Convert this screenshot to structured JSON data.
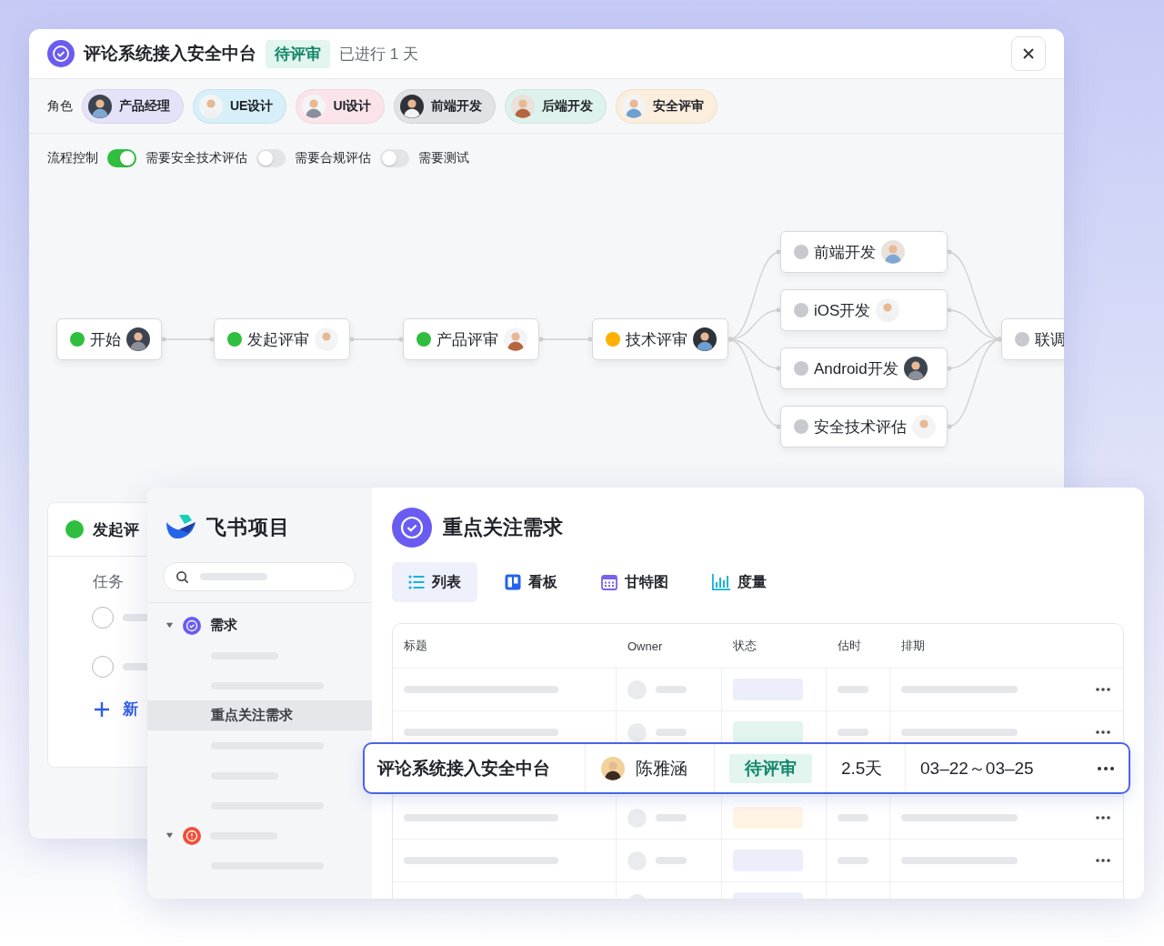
{
  "window": {
    "title": "评论系统接入安全中台",
    "status": "待评审",
    "elapsed": "已进行 1 天"
  },
  "roles": {
    "label": "角色",
    "items": [
      {
        "name": "产品经理",
        "color": "#e4e2f8"
      },
      {
        "name": "UE设计",
        "color": "#d6eff8"
      },
      {
        "name": "UI设计",
        "color": "#fae4ea"
      },
      {
        "name": "前端开发",
        "color": "#e1e2e6"
      },
      {
        "name": "后端开发",
        "color": "#ddf2ec"
      },
      {
        "name": "安全评审",
        "color": "#fbeedc"
      }
    ]
  },
  "flow_control": {
    "label": "流程控制",
    "options": [
      {
        "on": true,
        "label": "需要安全技术评估"
      },
      {
        "on": false,
        "label": "需要合规评估"
      },
      {
        "on": false,
        "label": "需要测试"
      }
    ]
  },
  "flow": {
    "stages": [
      [
        {
          "label": "开始",
          "color": "#2fbe3e",
          "avatar": true
        }
      ],
      [
        {
          "label": "发起评审",
          "color": "#2fbe3e",
          "avatar": true
        }
      ],
      [
        {
          "label": "产品评审",
          "color": "#2fbe3e",
          "avatar": true
        }
      ],
      [
        {
          "label": "技术评审",
          "color": "#ffb000",
          "avatar": true
        }
      ],
      [
        {
          "label": "前端开发",
          "color": "#c8c9cf",
          "avatar": true
        },
        {
          "label": "iOS开发",
          "color": "#c8c9cf",
          "avatar": true
        },
        {
          "label": "Android开发",
          "color": "#c8c9cf",
          "avatar": true
        },
        {
          "label": "安全技术评估",
          "color": "#c8c9cf",
          "avatar": true
        }
      ],
      [
        {
          "label": "联调",
          "color": "#c8c9cf",
          "avatar": false
        }
      ]
    ]
  },
  "stage_card": {
    "title": "发起评",
    "color": "#2fbe3e",
    "section": "任务",
    "tasks": [
      {
        "checked": false
      },
      {
        "checked": false
      }
    ],
    "add": "新"
  },
  "app": {
    "logo": "飞书项目",
    "sidebar": {
      "groups": [
        {
          "kind": "requirement",
          "label": "需求",
          "expanded": true,
          "children": [
            {
              "kind": "short",
              "selected": false
            },
            {
              "kind": "long",
              "selected": false
            },
            {
              "kind": "item",
              "label": "重点关注需求",
              "selected": true
            },
            {
              "kind": "long",
              "selected": false
            },
            {
              "kind": "short",
              "selected": false
            },
            {
              "kind": "long",
              "selected": false
            }
          ]
        },
        {
          "kind": "issue",
          "expanded": true,
          "children": [
            {
              "kind": "long",
              "selected": false
            }
          ]
        }
      ]
    },
    "page": {
      "title": "重点关注需求",
      "tabs": [
        {
          "label": "列表",
          "kind": "list",
          "selected": true
        },
        {
          "label": "看板",
          "kind": "board",
          "selected": false
        },
        {
          "label": "甘特图",
          "kind": "gantt",
          "selected": false
        },
        {
          "label": "度量",
          "kind": "metrics",
          "selected": false
        }
      ],
      "table": {
        "columns": [
          "标题",
          "Owner",
          "状态",
          "估时",
          "排期"
        ],
        "rows": [
          {
            "kind": "placeholder",
            "color": "#eceefb"
          },
          {
            "kind": "placeholder",
            "color": "#e2f5ef"
          },
          {
            "kind": "focus",
            "title": "评论系统接入安全中台",
            "owner": "陈雅涵",
            "status": "待评审",
            "estimate": "2.5天",
            "schedule": "03–22～03–25"
          },
          {
            "kind": "placeholder",
            "color": "#fff4e4"
          },
          {
            "kind": "placeholder",
            "color": "#eceefb"
          },
          {
            "kind": "partial",
            "color": "#eceefb"
          }
        ]
      }
    }
  }
}
